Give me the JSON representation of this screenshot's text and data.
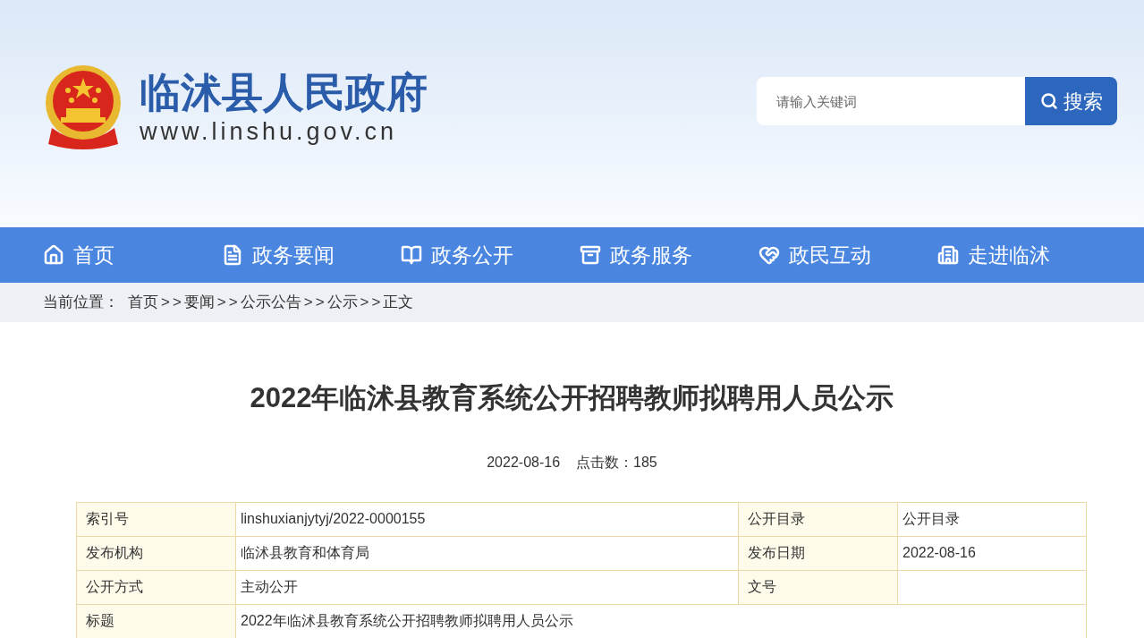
{
  "header": {
    "site_title": "临沭县人民政府",
    "site_url": "www.linshu.gov.cn",
    "search": {
      "placeholder": "请输入关键词",
      "button": "搜索"
    }
  },
  "nav": [
    {
      "label": "首页"
    },
    {
      "label": "政务要闻"
    },
    {
      "label": "政务公开"
    },
    {
      "label": "政务服务"
    },
    {
      "label": "政民互动"
    },
    {
      "label": "走进临沭"
    }
  ],
  "breadcrumb": {
    "label": "当前位置：",
    "items": [
      {
        "text": "首页",
        "kind": "link"
      },
      {
        "text": ">>",
        "kind": "separator"
      },
      {
        "text": "要闻",
        "kind": "link"
      },
      {
        "text": ">>",
        "kind": "separator"
      },
      {
        "text": "公示公告",
        "kind": "link"
      },
      {
        "text": ">>",
        "kind": "separator"
      },
      {
        "text": "公示",
        "kind": "link"
      },
      {
        "text": ">>",
        "kind": "separator"
      },
      {
        "text": "正文",
        "kind": "link"
      }
    ]
  },
  "article": {
    "title": "2022年临沭县教育系统公开招聘教师拟聘用人员公示",
    "date": "2022-08-16",
    "views": "点击数：185"
  },
  "info_table": [
    [
      {
        "label": "索引号",
        "value": "linshuxianjytyj/2022-0000155"
      },
      {
        "label": "公开目录",
        "value": "公开目录"
      }
    ],
    [
      {
        "label": "发布机构",
        "value": "临沭县教育和体育局"
      },
      {
        "label": "发布日期",
        "value": "2022-08-16"
      }
    ],
    [
      {
        "label": "公开方式",
        "value": "主动公开"
      },
      {
        "label": "文号"
      }
    ],
    [
      {
        "label": "标题",
        "value": "2022年临沭县教育系统公开招聘教师拟聘用人员公示"
      }
    ]
  ]
}
